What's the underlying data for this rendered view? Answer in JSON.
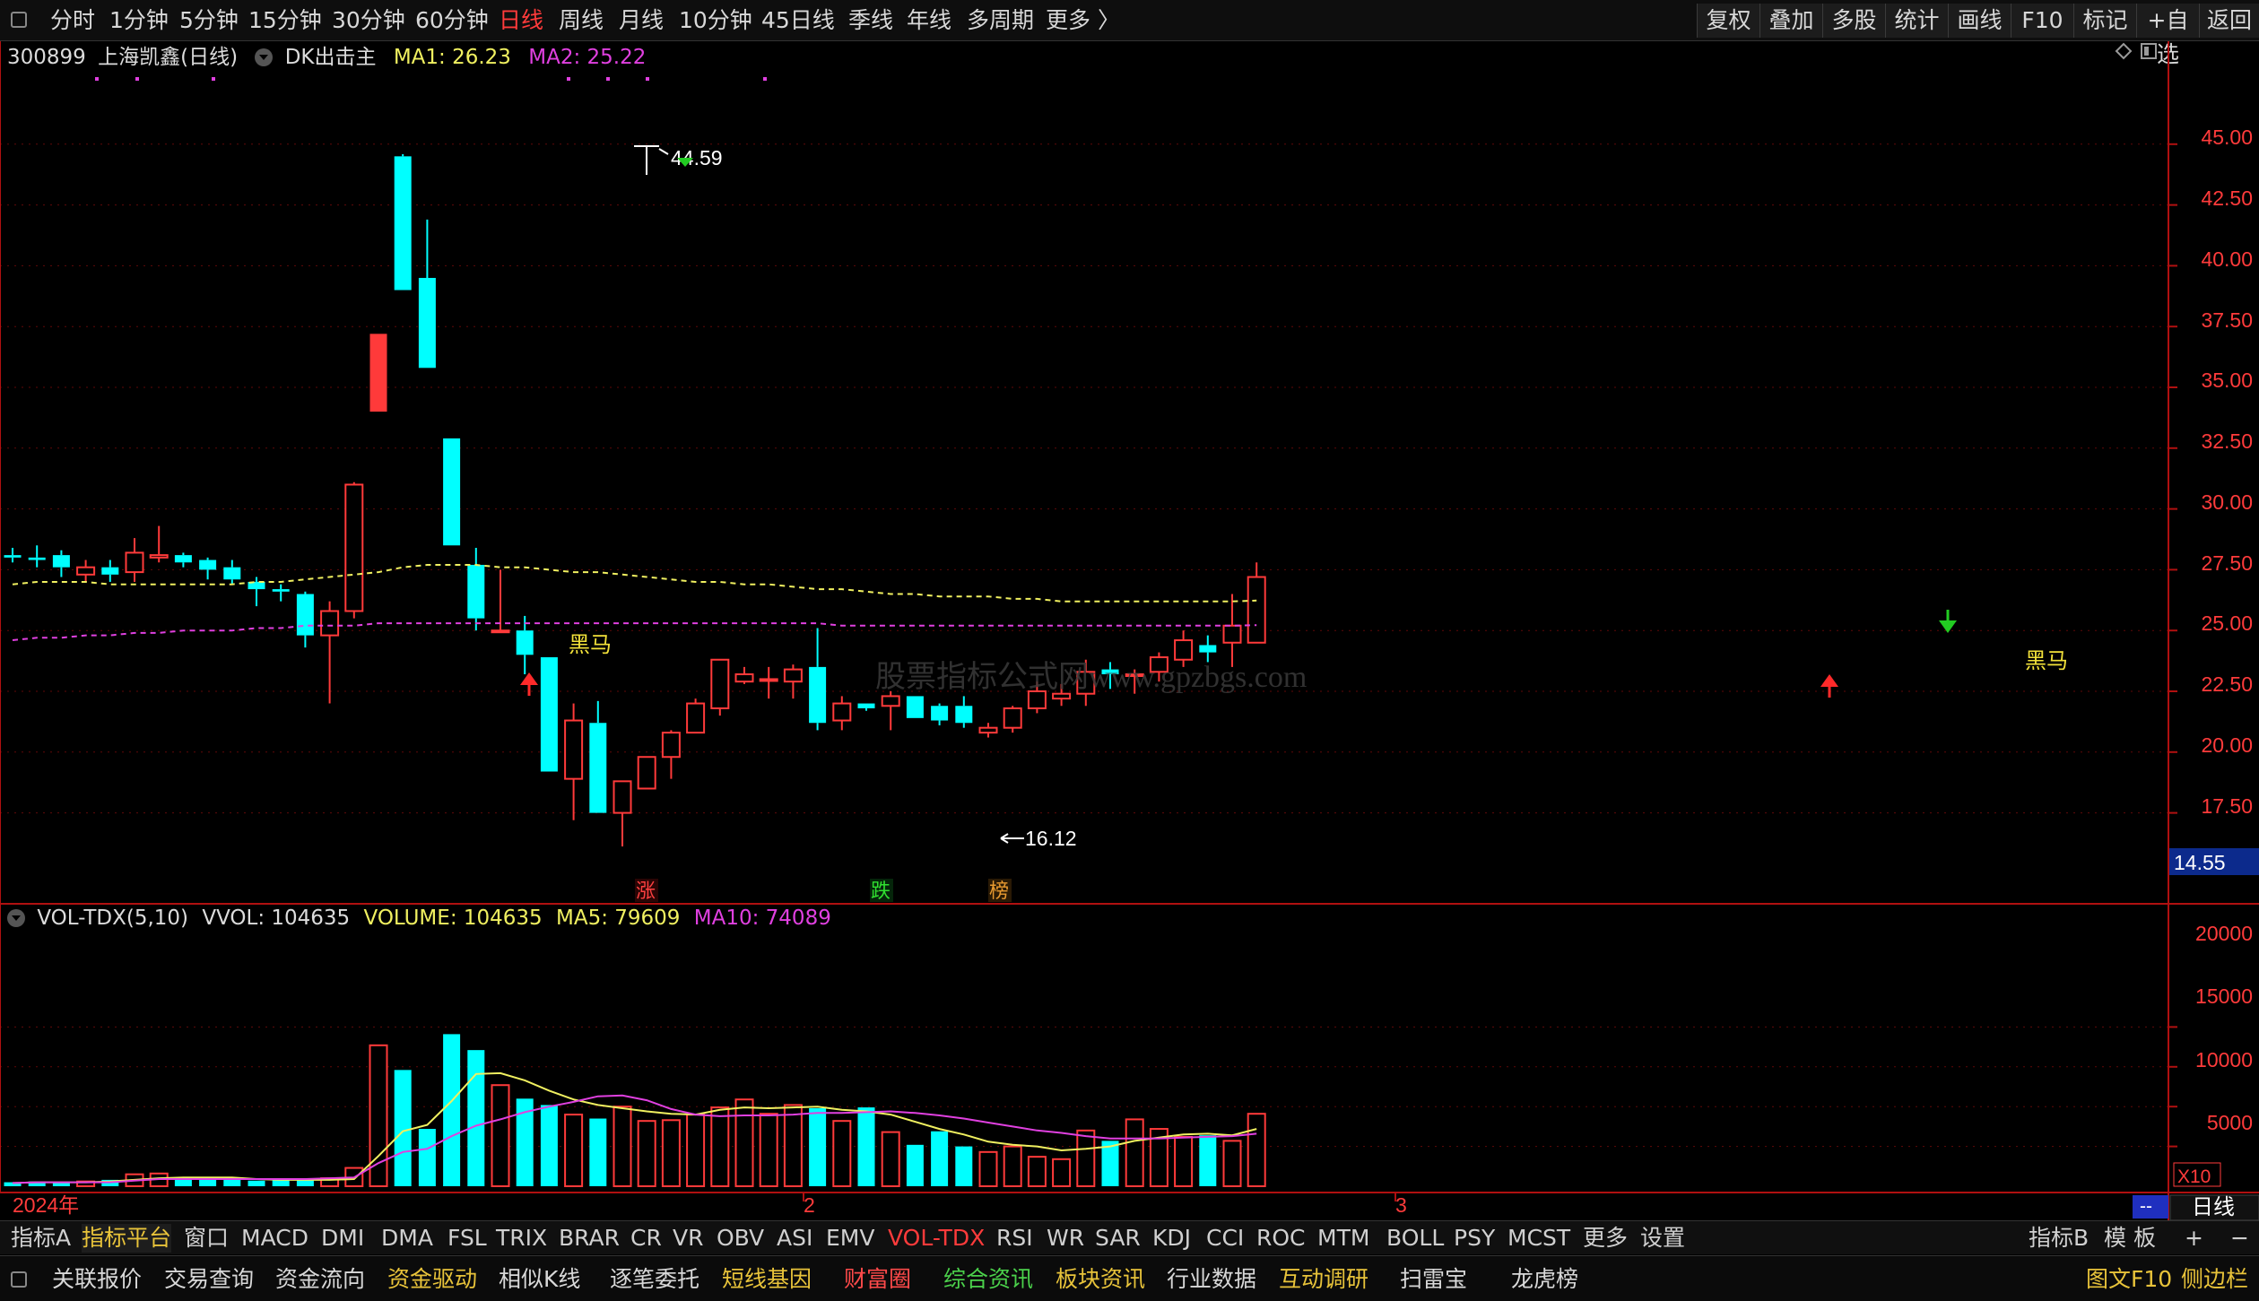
{
  "top_periods": [
    "分时",
    "1分钟",
    "5分钟",
    "15分钟",
    "30分钟",
    "60分钟",
    "日线",
    "周线",
    "月线",
    "10分钟",
    "45日线",
    "季线",
    "年线",
    "多周期",
    "更多 〉"
  ],
  "active_period": "日线",
  "top_right": [
    "复权",
    "叠加",
    "多股",
    "统计",
    "画线",
    "F10",
    "标记",
    "+自选",
    "返回"
  ],
  "stock": {
    "code": "300899",
    "name": "上海凯鑫",
    "period": "(日线)"
  },
  "price_indicator": {
    "name": "DK出击主",
    "ma1_label": "MA1: 26.23",
    "ma2_label": "MA2: 25.22"
  },
  "vol_indicator": {
    "name": "VOL-TDX(5,10)",
    "vvol": "VVOL: 104635",
    "volume": "VOLUME: 104635",
    "ma5": "MA5: 79609",
    "ma10": "MA10: 74089"
  },
  "annotations": {
    "high": "44.59",
    "low": "16.12",
    "signal_text": "黑马",
    "zhang": "涨",
    "die": "跌",
    "bang": "榜",
    "watermark": "股票指标公式网www.gpzbgs.com"
  },
  "price_axis": [
    "45.00",
    "42.50",
    "40.00",
    "37.50",
    "35.00",
    "32.50",
    "30.00",
    "27.50",
    "25.00",
    "22.50",
    "20.00",
    "17.50"
  ],
  "current_price": "14.55",
  "volume_axis": [
    "20000",
    "15000",
    "10000",
    "5000"
  ],
  "volume_unit": "X10",
  "date_labels": [
    "2024年",
    "2",
    "3"
  ],
  "period_label": "日线",
  "blue_tag": "--",
  "indicator_tabs": [
    "指标A",
    "指标平台",
    "窗口",
    "MACD",
    "DMI",
    "DMA",
    "FSL",
    "TRIX",
    "BRAR",
    "CR",
    "VR",
    "OBV",
    "ASI",
    "EMV",
    "VOL-TDX",
    "RSI",
    "WR",
    "SAR",
    "KDJ",
    "CCI",
    "ROC",
    "MTM",
    "BOLL",
    "PSY",
    "MCST",
    "更多",
    "设置"
  ],
  "indicator_right": [
    "指标B",
    "模 板",
    "+",
    "−"
  ],
  "bottom_tabs": [
    "关联报价",
    "交易查询",
    "资金流向",
    "资金驱动",
    "相似K线",
    "逐笔委托",
    "短线基因",
    "财富圈",
    "综合资讯",
    "板块资讯",
    "行业数据",
    "互动调研",
    "扫雷宝",
    "龙虎榜"
  ],
  "bottom_right": [
    "图文F10",
    "侧边栏"
  ],
  "colors": {
    "up": "#ff3a3a",
    "down": "#00ffff",
    "ma1": "#f0f060",
    "ma2": "#e040e0",
    "grid": "#b01010",
    "axis_text": "#ff3b3b",
    "gold": "#e8c33a"
  },
  "chart_data": {
    "type": "candlestick",
    "title": "上海凯鑫(日线)",
    "ylim": [
      14.55,
      46.5
    ],
    "ohlc": [
      [
        28.1,
        28.4,
        27.8,
        28.0
      ],
      [
        28.0,
        28.5,
        27.6,
        27.9
      ],
      [
        28.1,
        28.3,
        27.2,
        27.6
      ],
      [
        27.3,
        27.9,
        27.0,
        27.6
      ],
      [
        27.6,
        27.9,
        27.0,
        27.3
      ],
      [
        27.4,
        28.8,
        27.0,
        28.2
      ],
      [
        28.0,
        29.3,
        27.8,
        28.1
      ],
      [
        28.1,
        28.2,
        27.6,
        27.8
      ],
      [
        27.9,
        28.0,
        27.1,
        27.5
      ],
      [
        27.6,
        27.9,
        26.9,
        27.1
      ],
      [
        27.0,
        27.2,
        26.0,
        26.7
      ],
      [
        26.7,
        26.9,
        26.2,
        26.6
      ],
      [
        26.5,
        26.6,
        24.3,
        24.8
      ],
      [
        24.8,
        26.2,
        22.0,
        25.8
      ],
      [
        25.8,
        31.1,
        25.5,
        31.0
      ],
      [
        34.0,
        37.2,
        34.0,
        37.2
      ],
      [
        44.5,
        44.59,
        39.0,
        39.0
      ],
      [
        39.5,
        41.9,
        35.8,
        35.8
      ],
      [
        32.9,
        32.9,
        28.5,
        28.5
      ],
      [
        27.7,
        28.4,
        25.0,
        25.5
      ],
      [
        25.0,
        27.5,
        24.9,
        25.0
      ],
      [
        25.0,
        25.6,
        23.2,
        24.0
      ],
      [
        23.9,
        23.9,
        19.2,
        19.2
      ],
      [
        18.9,
        22.0,
        17.2,
        21.3
      ],
      [
        21.2,
        22.1,
        17.5,
        17.5
      ],
      [
        17.5,
        18.8,
        16.12,
        18.8
      ],
      [
        18.5,
        19.8,
        18.5,
        19.8
      ],
      [
        19.8,
        20.9,
        18.9,
        20.8
      ],
      [
        20.8,
        22.2,
        20.8,
        22.0
      ],
      [
        21.8,
        23.8,
        21.5,
        23.8
      ],
      [
        22.9,
        23.5,
        22.8,
        23.2
      ],
      [
        23.0,
        23.5,
        22.2,
        23.0
      ],
      [
        22.9,
        23.6,
        22.2,
        23.4
      ],
      [
        23.5,
        25.1,
        20.9,
        21.2
      ],
      [
        21.3,
        22.3,
        20.9,
        22.0
      ],
      [
        22.0,
        22.0,
        21.7,
        21.8
      ],
      [
        21.9,
        22.5,
        20.9,
        22.3
      ],
      [
        22.3,
        22.3,
        21.4,
        21.4
      ],
      [
        21.9,
        22.0,
        21.1,
        21.3
      ],
      [
        21.9,
        22.3,
        21.0,
        21.2
      ],
      [
        20.8,
        21.2,
        20.6,
        21.0
      ],
      [
        21.0,
        21.9,
        20.8,
        21.8
      ],
      [
        21.8,
        22.9,
        21.6,
        22.5
      ],
      [
        22.2,
        22.8,
        21.9,
        22.4
      ],
      [
        22.4,
        23.8,
        21.9,
        23.3
      ],
      [
        23.4,
        23.7,
        22.6,
        23.2
      ],
      [
        23.2,
        23.4,
        22.4,
        23.2
      ],
      [
        23.3,
        24.1,
        22.9,
        23.9
      ],
      [
        23.8,
        25.0,
        23.5,
        24.6
      ],
      [
        24.4,
        24.8,
        23.7,
        24.1
      ],
      [
        24.5,
        26.5,
        23.5,
        25.2
      ],
      [
        24.5,
        27.8,
        24.5,
        27.2
      ]
    ],
    "volume": [
      5,
      6,
      5,
      6,
      8,
      15,
      16,
      9,
      8,
      9,
      7,
      8,
      8,
      10,
      23,
      177,
      146,
      72,
      191,
      171,
      127,
      110,
      102,
      90,
      85,
      100,
      82,
      83,
      90,
      99,
      109,
      91,
      102,
      98,
      82,
      99,
      68,
      52,
      69,
      50,
      43,
      50,
      37,
      34,
      70,
      57,
      84,
      72,
      62,
      64,
      57,
      91,
      104.6
    ],
    "ma1": [
      26.9,
      27.0,
      27.0,
      27.0,
      26.9,
      26.9,
      26.9,
      26.9,
      26.9,
      26.9,
      27.0,
      27.0,
      27.1,
      27.2,
      27.3,
      27.4,
      27.6,
      27.7,
      27.7,
      27.7,
      27.6,
      27.6,
      27.5,
      27.4,
      27.4,
      27.3,
      27.2,
      27.1,
      27.0,
      27.0,
      26.9,
      26.9,
      26.8,
      26.7,
      26.7,
      26.6,
      26.5,
      26.5,
      26.4,
      26.4,
      26.4,
      26.3,
      26.3,
      26.2,
      26.2,
      26.2,
      26.2,
      26.2,
      26.2,
      26.2,
      26.2,
      26.23
    ],
    "ma2": [
      24.6,
      24.7,
      24.7,
      24.8,
      24.8,
      24.9,
      24.9,
      25.0,
      25.0,
      25.0,
      25.1,
      25.1,
      25.2,
      25.2,
      25.2,
      25.3,
      25.3,
      25.3,
      25.3,
      25.3,
      25.3,
      25.3,
      25.3,
      25.3,
      25.3,
      25.3,
      25.3,
      25.3,
      25.3,
      25.3,
      25.3,
      25.3,
      25.3,
      25.3,
      25.2,
      25.2,
      25.2,
      25.2,
      25.2,
      25.2,
      25.2,
      25.2,
      25.2,
      25.2,
      25.2,
      25.2,
      25.2,
      25.2,
      25.2,
      25.2,
      25.2,
      25.22
    ],
    "volume_ma5": [
      4,
      5,
      5,
      5,
      6,
      8,
      10,
      11,
      11,
      11,
      9,
      8,
      8,
      8,
      9,
      38,
      69,
      77,
      107,
      141,
      142,
      133,
      120,
      109,
      102,
      98,
      94,
      91,
      90,
      96,
      99,
      98,
      99,
      100,
      96,
      94,
      90,
      81,
      72,
      65,
      56,
      52,
      50,
      45,
      47,
      50,
      57,
      61,
      65,
      66,
      64,
      72,
      79.6
    ],
    "volume_ma10": [
      4,
      5,
      5,
      5,
      5,
      7,
      9,
      9,
      9,
      9,
      9,
      9,
      9,
      10,
      11,
      29,
      43,
      47,
      63,
      76,
      84,
      93,
      100,
      106,
      113,
      114,
      108,
      97,
      90,
      88,
      89,
      89,
      90,
      92,
      92,
      93,
      94,
      92,
      89,
      85,
      80,
      75,
      70,
      67,
      63,
      60,
      60,
      60,
      61,
      62,
      63,
      66,
      74.1
    ]
  }
}
